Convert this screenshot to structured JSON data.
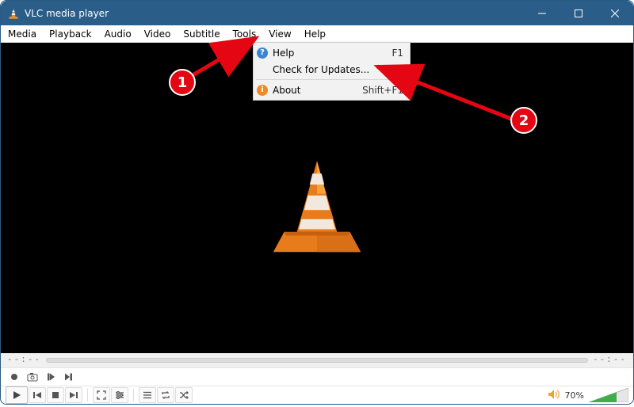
{
  "title": "VLC media player",
  "menubar": [
    "Media",
    "Playback",
    "Audio",
    "Video",
    "Subtitle",
    "Tools",
    "View",
    "Help"
  ],
  "help_menu": {
    "items": [
      {
        "icon": "question",
        "label": "Help",
        "shortcut": "F1"
      },
      {
        "icon": "",
        "label": "Check for Updates...",
        "shortcut": ""
      },
      {
        "sep": true
      },
      {
        "icon": "info",
        "label": "About",
        "shortcut": "Shift+F1"
      }
    ]
  },
  "seekbar": {
    "left": "--:--",
    "right": "--:--"
  },
  "volume": {
    "percent": "70%"
  },
  "annotations": {
    "badge1": "1",
    "badge2": "2"
  }
}
